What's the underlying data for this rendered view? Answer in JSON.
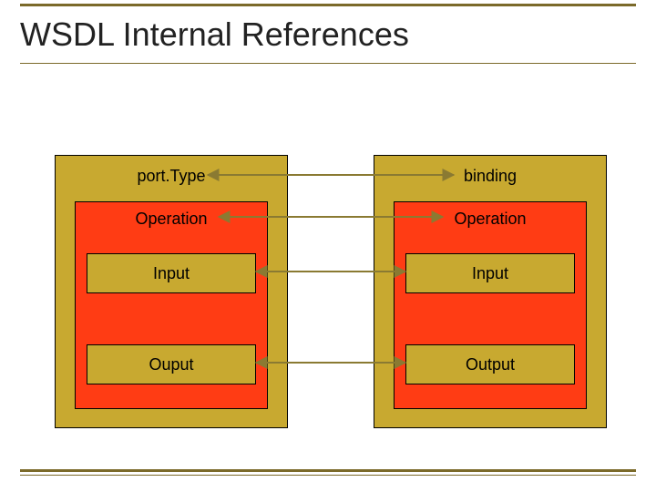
{
  "title": "WSDL Internal References",
  "left": {
    "name": "port.Type",
    "operation": "Operation",
    "input": "Input",
    "output": "Ouput"
  },
  "right": {
    "name": "binding",
    "operation": "Operation",
    "input": "Input",
    "output": "Output"
  },
  "colors": {
    "accent_rule": "#7b6a2a",
    "outer_fill": "#c8a930",
    "inner_fill": "#ff3c14",
    "connector": "#8a7a32"
  },
  "chart_data": {
    "type": "diagram",
    "title": "WSDL Internal References",
    "nodes": [
      {
        "id": "portType",
        "label": "port.Type",
        "parent": null,
        "side": "left"
      },
      {
        "id": "opL",
        "label": "Operation",
        "parent": "portType",
        "side": "left"
      },
      {
        "id": "inL",
        "label": "Input",
        "parent": "opL",
        "side": "left"
      },
      {
        "id": "outL",
        "label": "Ouput",
        "parent": "opL",
        "side": "left"
      },
      {
        "id": "binding",
        "label": "binding",
        "parent": null,
        "side": "right"
      },
      {
        "id": "opR",
        "label": "Operation",
        "parent": "binding",
        "side": "right"
      },
      {
        "id": "inR",
        "label": "Input",
        "parent": "opR",
        "side": "right"
      },
      {
        "id": "outR",
        "label": "Output",
        "parent": "opR",
        "side": "right"
      }
    ],
    "edges": [
      {
        "from": "portType",
        "to": "binding",
        "bidirectional": true
      },
      {
        "from": "opL",
        "to": "opR",
        "bidirectional": true
      },
      {
        "from": "inL",
        "to": "inR",
        "bidirectional": true
      },
      {
        "from": "outL",
        "to": "outR",
        "bidirectional": true
      }
    ]
  }
}
